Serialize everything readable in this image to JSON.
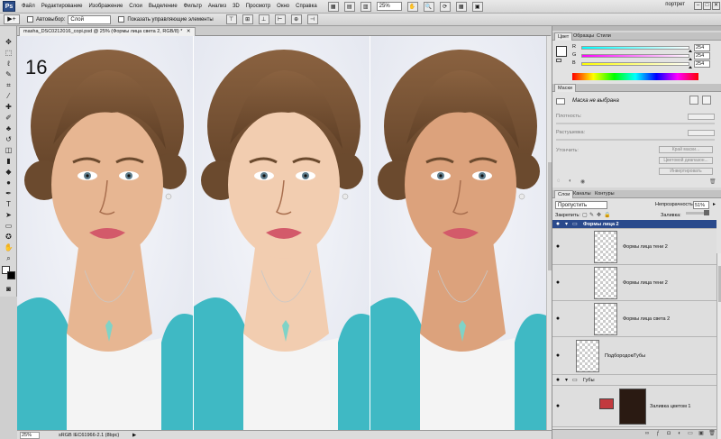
{
  "menu": {
    "app_logo": "Ps",
    "items": [
      "Файл",
      "Редактирование",
      "Изображение",
      "Слои",
      "Выделение",
      "Фильтр",
      "Анализ",
      "3D",
      "Просмотр",
      "Окно",
      "Справка"
    ],
    "zoom": "25%",
    "workspace": "портрет",
    "window_buttons": [
      "–",
      "□",
      "✕"
    ]
  },
  "options": {
    "tool_glyph": "▶+",
    "autoselect_label": "Автовыбор:",
    "autoselect_value": "Слой",
    "show_controls_label": "Показать управляющие элементы"
  },
  "document": {
    "tab_title": "masha_DSC0212016_copi.psd @ 25% (Формы лица света 2, RGB/8) *",
    "frame_number": "16",
    "status_zoom": "25%",
    "status_profile": "sRGB IEC61966-2.1 (8bpc)"
  },
  "color_panel": {
    "tabs": [
      "Цвет",
      "Образцы",
      "Стили"
    ],
    "sliders": [
      {
        "label": "R",
        "value": "254",
        "fraction": 1.0,
        "gradient": "linear-gradient(to right, #00ffff, #ffffff)"
      },
      {
        "label": "G",
        "value": "254",
        "fraction": 1.0,
        "gradient": "linear-gradient(to right, #ff00ff, #ffffff)"
      },
      {
        "label": "B",
        "value": "254",
        "fraction": 1.0,
        "gradient": "linear-gradient(to right, #ffff00, #ffffff)"
      }
    ]
  },
  "masks_panel": {
    "title": "Маски",
    "status": "Маска не выбрана",
    "density_label": "Плотность:",
    "feather_label": "Растушевка:",
    "refine_label": "Утончить:",
    "btn_mask_edge": "Край маски...",
    "btn_color_range": "Цветовой диапазон...",
    "btn_invert": "Инвертировать"
  },
  "layers_panel": {
    "tabs": [
      "Слои",
      "Каналы",
      "Контуры"
    ],
    "blend_mode": "Пропустить",
    "opacity_label": "Непрозрачность:",
    "opacity_value": "51%",
    "lock_label": "Закрепить:",
    "fill_label": "Заливка:",
    "fill_value": "100%",
    "layers": [
      {
        "name": "Формы лица 2",
        "type": "group",
        "selected": true
      },
      {
        "name": "Формы лица тени 2",
        "type": "layer"
      },
      {
        "name": "Формы лица тени 2",
        "type": "layer"
      },
      {
        "name": "Формы лица света 2",
        "type": "layer"
      },
      {
        "name": "Подбородок/Губы",
        "type": "layer"
      },
      {
        "name": "Губы",
        "type": "group"
      },
      {
        "name": "Заливка цветом 1",
        "type": "fill",
        "swatch": "#c23a3e"
      }
    ]
  },
  "colors": {
    "accent": "#2a4a8c",
    "selected_layer": "#2a4a8c",
    "lip_swatch": "#c23a3e"
  }
}
